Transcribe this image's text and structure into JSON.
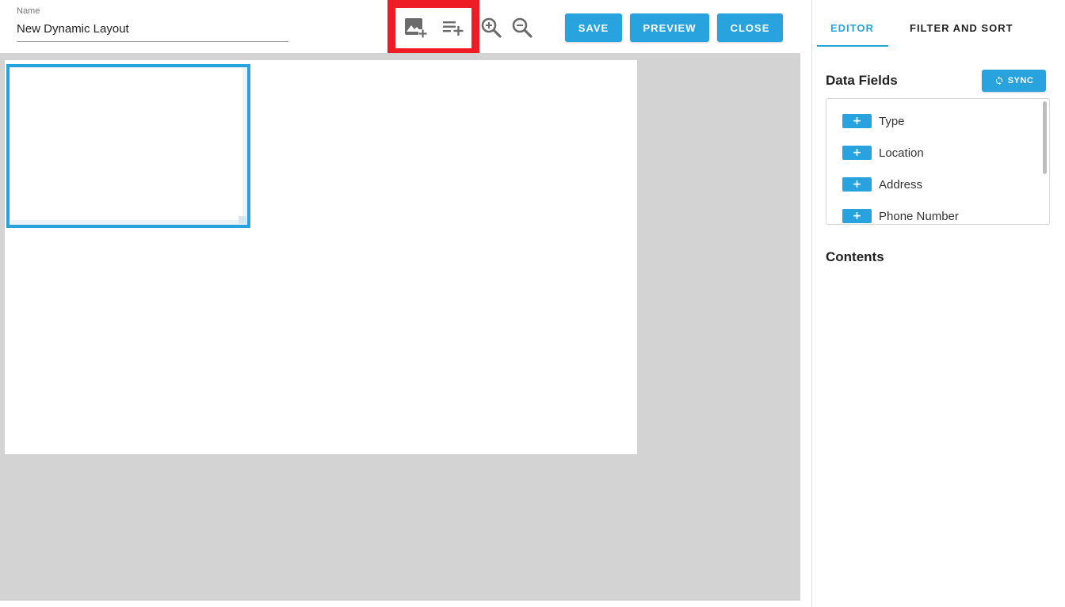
{
  "header": {
    "name_label": "Name",
    "name_value": "New Dynamic Layout",
    "tools": [
      {
        "icon": "add-image-icon"
      },
      {
        "icon": "add-text-icon"
      },
      {
        "icon": "zoom-in-icon"
      },
      {
        "icon": "zoom-out-icon"
      }
    ],
    "buttons": {
      "save": "SAVE",
      "preview": "PREVIEW",
      "close": "CLOSE"
    }
  },
  "panel": {
    "tabs": [
      {
        "label": "EDITOR",
        "active": true
      },
      {
        "label": "FILTER AND SORT",
        "active": false
      }
    ],
    "data_fields_title": "Data Fields",
    "sync_label": "SYNC",
    "data_fields": [
      {
        "add": "+",
        "label": "Type"
      },
      {
        "add": "+",
        "label": "Location"
      },
      {
        "add": "+",
        "label": "Address"
      },
      {
        "add": "+",
        "label": "Phone Number"
      }
    ],
    "contents_title": "Contents"
  },
  "colors": {
    "accent": "#29a3dd",
    "highlight": "#ee1c25",
    "canvas_background": "#d3d3d3"
  }
}
